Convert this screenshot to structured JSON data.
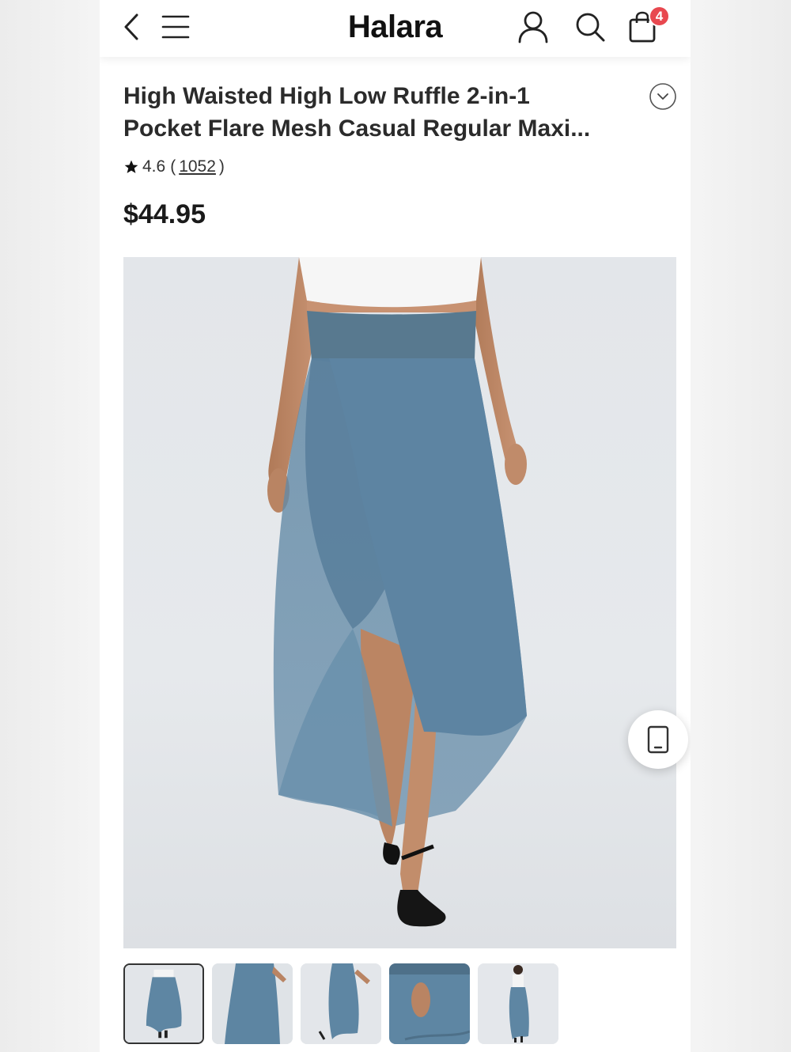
{
  "header": {
    "brand": "Halara",
    "cart_count": "4"
  },
  "product": {
    "title_line1": "High Waisted High Low Ruffle 2-in-1",
    "title_line2": "Pocket Flare Mesh Casual Regular Maxi...",
    "rating": "4.6",
    "rating_open": "(",
    "review_count": "1052",
    "rating_close": ")",
    "price": "$44.95"
  },
  "gallery": {
    "thumbnail_count": 5,
    "active_index": 0
  },
  "colors": {
    "skirt": "#5e86a3",
    "badge": "#e8484f",
    "background": "#e3e6ea"
  },
  "icons": [
    "back-icon",
    "menu-icon",
    "user-icon",
    "search-icon",
    "shopping-bag-icon",
    "chevron-down-icon",
    "star-icon",
    "phone-icon"
  ]
}
